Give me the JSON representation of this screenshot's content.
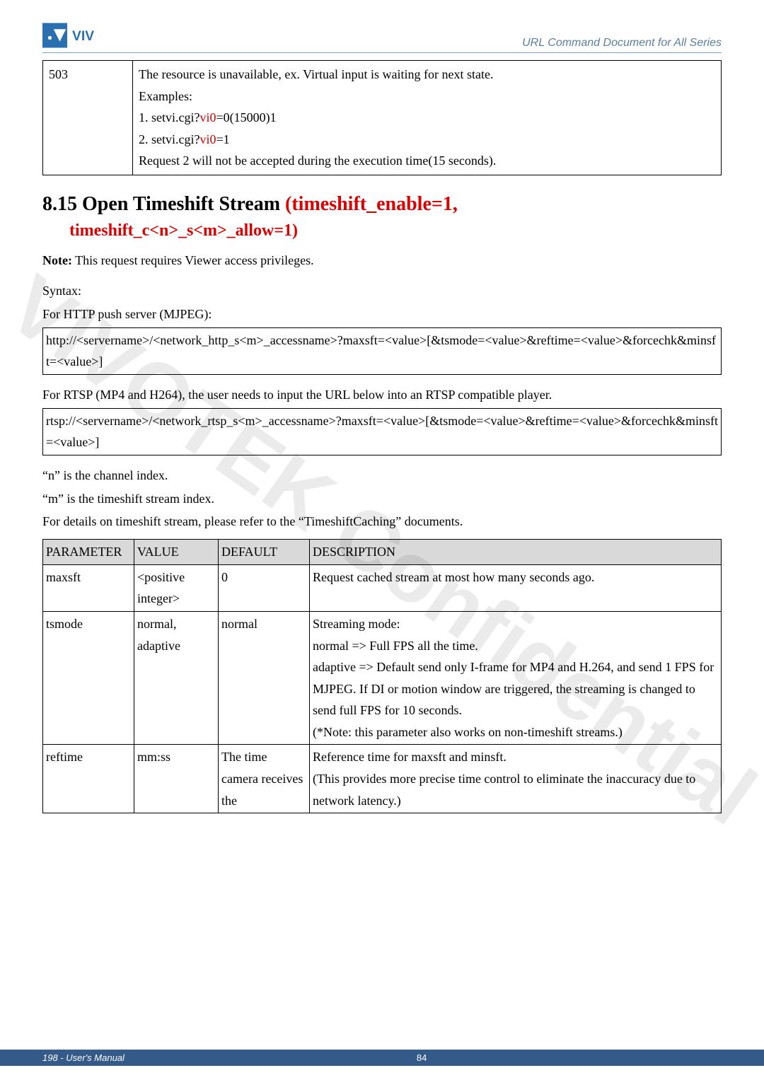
{
  "header": {
    "title": "URL Command Document for All Series"
  },
  "table503": {
    "code": "503",
    "line1": "The resource is unavailable, ex. Virtual input is waiting for next state.",
    "line2": "Examples:",
    "line3_pre": "1. setvi.cgi?",
    "line3_red": "vi0",
    "line3_post": "=0(15000)1",
    "line4_pre": "2. setvi.cgi?",
    "line4_red": "vi0",
    "line4_post": "=1",
    "line5": "Request 2 will not be accepted during the execution time(15 seconds)."
  },
  "section": {
    "title_black": "8.15 Open Timeshift Stream ",
    "title_red": "(timeshift_enable=1,",
    "sub_red": "timeshift_c<n>_s<m>_allow=1)"
  },
  "note": {
    "label": "Note:",
    "text": " This request requires Viewer access privileges."
  },
  "body": {
    "syntax": "Syntax:",
    "http_intro": "For HTTP push server (MJPEG):",
    "http_url": "http://<servername>/<network_http_s<m>_accessname>?maxsft=<value>[&tsmode=<value>&reftime=<value>&forcechk&minsft=<value>]",
    "rtsp_intro": "For RTSP (MP4 and H264), the user needs to input the URL below into an RTSP compatible player.",
    "rtsp_url": "rtsp://<servername>/<network_rtsp_s<m>_accessname>?maxsft=<value>[&tsmode=<value>&reftime=<value>&forcechk&minsft=<value>]",
    "n_line": "“n” is the channel index.",
    "m_line": "“m” is the timeshift stream index.",
    "details_line": "For details on timeshift stream, please refer to the “TimeshiftCaching” documents."
  },
  "param_table": {
    "headers": [
      "PARAMETER",
      "VALUE",
      "DEFAULT",
      "DESCRIPTION"
    ],
    "rows": [
      {
        "param": "maxsft",
        "value": "<positive integer>",
        "default": "0",
        "desc": "Request cached stream at most how many seconds ago."
      },
      {
        "param": "tsmode",
        "value": "normal, adaptive",
        "default": "normal",
        "desc": "Streaming mode:\nnormal => Full FPS all the time.\nadaptive => Default send only I-frame for MP4 and H.264, and send 1 FPS for MJPEG. If DI or motion window are triggered, the streaming is changed to send full FPS for 10 seconds.\n(*Note: this parameter also works on non-timeshift streams.)"
      },
      {
        "param": "reftime",
        "value": "mm:ss",
        "default": "The time camera receives the",
        "desc": "Reference time for maxsft and minsft.\n(This provides more precise time control to eliminate the inaccuracy due to network latency.)"
      }
    ]
  },
  "footer": {
    "left": "198 - User's Manual",
    "pageno": "84"
  },
  "watermark": "VIVOTEK Confidential"
}
